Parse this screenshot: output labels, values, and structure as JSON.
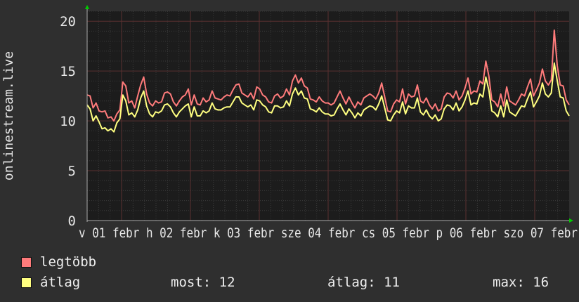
{
  "chart_data": {
    "type": "line",
    "ylabel": "onlinestream.live",
    "ylim": [
      0,
      21
    ],
    "y_ticks": [
      "0",
      "5",
      "10",
      "15",
      "20"
    ],
    "x_ticks": [
      "v 01",
      "febr",
      "h 02",
      "febr",
      "k 03",
      "febr",
      "sze 04",
      "febr",
      "cs 05",
      "febr",
      "p 06",
      "febr",
      "szo 07",
      "febr"
    ],
    "x_ticks_text": "v 01 febr h 02 febr k 03 febr sze 04 febr cs 05 febr p 06 febr szo 07 febr",
    "grid": true,
    "series": [
      {
        "name": "legtöbb",
        "color": "#ff7b7b",
        "values": [
          12.6,
          12.5,
          11.3,
          11.8,
          11.0,
          10.9,
          11.0,
          10.3,
          10.4,
          10.0,
          10.7,
          11.1,
          13.9,
          13.5,
          11.8,
          12.0,
          11.3,
          12.5,
          13.6,
          14.4,
          12.7,
          11.8,
          11.5,
          12.0,
          11.8,
          11.9,
          12.8,
          12.9,
          12.7,
          11.9,
          11.5,
          12.0,
          12.4,
          12.6,
          13.2,
          11.6,
          12.6,
          11.7,
          11.6,
          12.3,
          11.9,
          12.1,
          13.0,
          12.3,
          12.2,
          12.1,
          12.4,
          12.6,
          12.5,
          13.1,
          13.6,
          13.7,
          12.8,
          12.6,
          12.4,
          12.8,
          12.2,
          13.4,
          13.2,
          12.6,
          12.4,
          11.9,
          11.8,
          12.5,
          12.7,
          12.3,
          12.5,
          13.2,
          12.6,
          14.0,
          14.6,
          13.8,
          14.3,
          13.5,
          13.3,
          12.2,
          12.1,
          11.9,
          12.4,
          12.0,
          11.8,
          11.8,
          11.6,
          11.8,
          12.4,
          13.0,
          12.3,
          11.7,
          12.4,
          11.8,
          11.3,
          11.9,
          11.6,
          12.3,
          12.5,
          12.7,
          12.5,
          12.2,
          12.8,
          13.8,
          12.4,
          11.0,
          10.9,
          11.7,
          12.1,
          11.9,
          13.2,
          11.7,
          12.7,
          12.4,
          12.5,
          13.6,
          12.0,
          11.8,
          12.3,
          11.6,
          11.2,
          11.7,
          11.0,
          11.2,
          12.4,
          12.8,
          12.7,
          12.3,
          13.0,
          12.1,
          12.5,
          13.3,
          14.3,
          12.7,
          13.0,
          12.9,
          14.0,
          13.7,
          16.0,
          14.5,
          12.1,
          11.9,
          11.4,
          12.7,
          11.5,
          13.4,
          12.0,
          11.8,
          11.6,
          12.1,
          12.7,
          12.5,
          13.4,
          14.2,
          12.5,
          13.1,
          13.8,
          15.2,
          14.0,
          13.6,
          14.1,
          19.1,
          15.5,
          13.6,
          13.5,
          12.1,
          11.6
        ]
      },
      {
        "name": "átlag",
        "color": "#ffff80",
        "values": [
          11.6,
          11.2,
          10.0,
          10.5,
          9.9,
          9.2,
          9.3,
          9.0,
          9.2,
          8.9,
          9.8,
          10.2,
          12.6,
          12.0,
          10.6,
          10.8,
          10.4,
          11.1,
          12.3,
          13.0,
          11.5,
          10.7,
          10.4,
          10.9,
          10.8,
          11.0,
          11.6,
          11.7,
          11.4,
          10.8,
          10.4,
          10.9,
          11.2,
          11.5,
          11.7,
          10.4,
          11.4,
          10.5,
          10.5,
          11.0,
          10.8,
          11.0,
          11.8,
          11.2,
          11.1,
          11.1,
          11.3,
          11.4,
          11.4,
          11.9,
          12.4,
          12.4,
          11.8,
          11.6,
          11.4,
          11.6,
          11.1,
          12.1,
          12.0,
          11.6,
          11.4,
          10.9,
          10.8,
          11.5,
          11.5,
          11.3,
          11.4,
          12.0,
          11.5,
          12.7,
          13.3,
          12.6,
          13.0,
          12.3,
          12.2,
          11.2,
          11.1,
          10.9,
          11.3,
          10.9,
          10.7,
          10.7,
          10.5,
          10.6,
          11.2,
          11.7,
          11.1,
          10.6,
          11.2,
          10.8,
          10.3,
          10.8,
          10.5,
          11.1,
          11.3,
          11.5,
          11.4,
          11.1,
          11.7,
          12.5,
          11.3,
          10.1,
          10.0,
          10.6,
          11.0,
          10.8,
          11.9,
          10.7,
          11.5,
          11.3,
          11.3,
          12.3,
          10.9,
          10.6,
          11.1,
          10.5,
          10.2,
          10.6,
          10.0,
          10.2,
          11.2,
          11.6,
          11.5,
          11.1,
          11.8,
          11.0,
          11.4,
          12.1,
          13.0,
          11.6,
          11.8,
          11.7,
          12.7,
          12.4,
          14.4,
          13.1,
          11.0,
          10.8,
          10.4,
          11.5,
          10.4,
          12.1,
          10.9,
          10.7,
          10.5,
          11.0,
          11.5,
          11.4,
          12.2,
          12.9,
          11.4,
          11.9,
          12.5,
          13.8,
          12.7,
          12.4,
          12.8,
          15.8,
          14.0,
          12.4,
          12.3,
          11.0,
          10.5
        ]
      }
    ]
  },
  "legend": {
    "max_label": "legtöbb",
    "avg_label": "átlag",
    "now_text": "most: 12",
    "avg_text": "átlag: 11",
    "max_text": "max: 16"
  }
}
